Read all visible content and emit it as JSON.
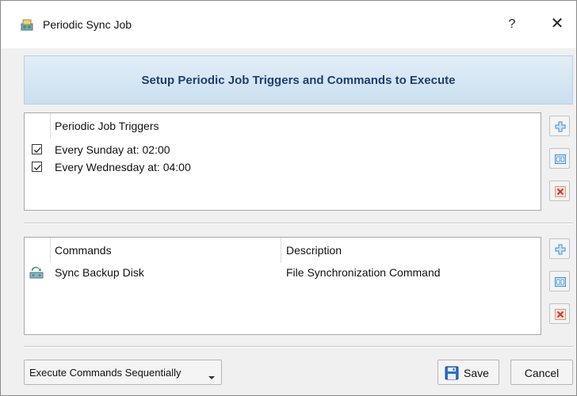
{
  "window": {
    "title": "Periodic Sync Job",
    "help_glyph": "?",
    "close_glyph": "✕",
    "icon": "sync-job-app-icon"
  },
  "banner": {
    "text": "Setup Periodic Job Triggers and Commands to Execute",
    "text_color": "#1e3f6e"
  },
  "triggers": {
    "header": "Periodic Job Triggers",
    "items": [
      {
        "label": "Every Sunday at: 02:00",
        "checked": true
      },
      {
        "label": "Every Wednesday at: 04:00",
        "checked": true
      }
    ],
    "buttons": [
      "add-icon",
      "edit-icon",
      "delete-icon"
    ]
  },
  "commands": {
    "headers": [
      "Commands",
      "Description"
    ],
    "rows": [
      {
        "icon": "sync-disk-icon",
        "command": "Sync Backup Disk",
        "description": "File Synchronization Command"
      }
    ],
    "buttons": [
      "add-icon",
      "edit-icon",
      "delete-icon"
    ]
  },
  "footer": {
    "exec_mode": "Execute Commands Sequentially",
    "save_label": "Save",
    "cancel_label": "Cancel"
  },
  "colors": {
    "accent_blue": "#3a8fd6",
    "delete_red": "#d9342b",
    "banner_bg": "#d4e6f4"
  }
}
